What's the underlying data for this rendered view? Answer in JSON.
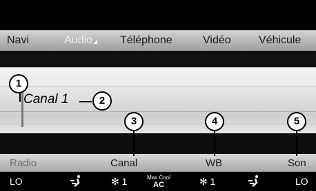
{
  "menu": {
    "items": [
      {
        "label": "Navi",
        "active": false
      },
      {
        "label": "Audio",
        "active": true,
        "caret": "◢"
      },
      {
        "label": "Téléphone",
        "active": false
      },
      {
        "label": "Vidéo",
        "active": false
      },
      {
        "label": "Véhicule",
        "active": false
      }
    ]
  },
  "main": {
    "channel": "Canal 1"
  },
  "softkeys": {
    "radio": "Radio",
    "canal": "Canal",
    "wb": "WB",
    "son": "Son"
  },
  "climate": {
    "temp_left": "LO",
    "fan_left": "1",
    "max_cool_top": "Max Cool",
    "max_cool_bottom": "AC",
    "fan_right": "1",
    "temp_right": "LO"
  },
  "callouts": [
    "1",
    "2",
    "3",
    "4",
    "5"
  ],
  "colors": {
    "menu_active": "#f0f0f0",
    "softkey_disabled": "#6f6f6f",
    "climate_text": "#ffffff"
  }
}
